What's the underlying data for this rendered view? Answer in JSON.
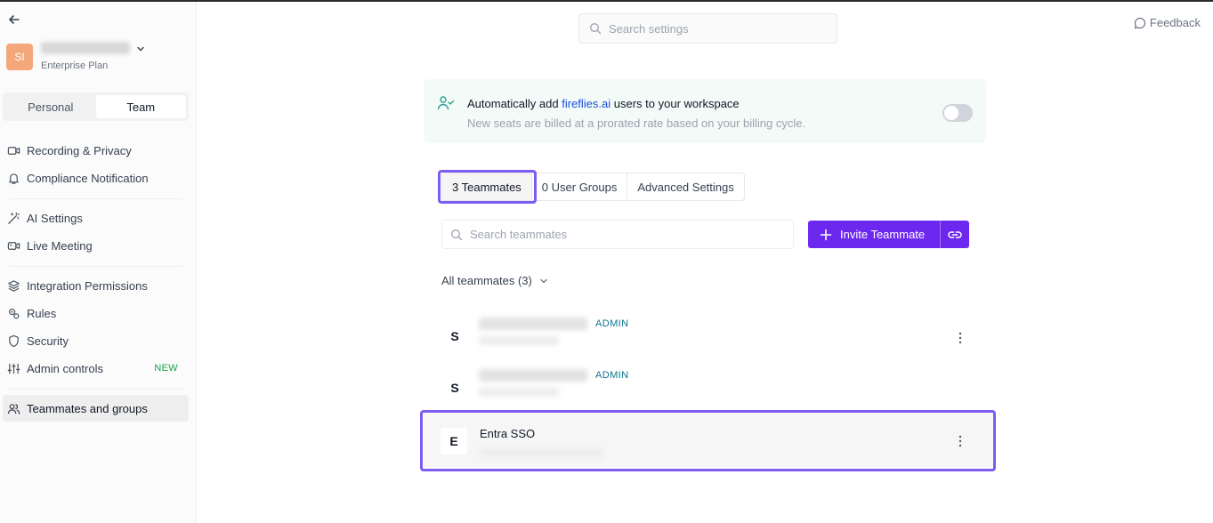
{
  "sidebar": {
    "account": {
      "initials": "SI",
      "plan": "Enterprise Plan"
    },
    "segment": {
      "personal": "Personal",
      "team": "Team"
    },
    "items": [
      {
        "label": "Recording & Privacy",
        "icon": "video-icon"
      },
      {
        "label": "Compliance Notification",
        "icon": "bell-icon"
      },
      {
        "label": "AI Settings",
        "icon": "magic-wand-icon"
      },
      {
        "label": "Live Meeting",
        "icon": "live-video-icon"
      },
      {
        "label": "Integration Permissions",
        "icon": "layers-icon"
      },
      {
        "label": "Rules",
        "icon": "gears-icon"
      },
      {
        "label": "Security",
        "icon": "shield-icon"
      },
      {
        "label": "Admin controls",
        "icon": "sliders-icon",
        "badge": "NEW"
      },
      {
        "label": "Teammates and groups",
        "icon": "users-icon",
        "active": true
      }
    ]
  },
  "header": {
    "search_placeholder": "Search settings",
    "feedback": "Feedback"
  },
  "banner": {
    "title_prefix": "Automatically add ",
    "title_link": "fireflies.ai",
    "title_suffix": " users to your workspace",
    "subtitle": "New seats are billed at a prorated rate based on your billing cycle.",
    "toggle_on": false
  },
  "tabs": [
    {
      "label": "3 Teammates",
      "active": true
    },
    {
      "label": "0 User Groups"
    },
    {
      "label": "Advanced Settings"
    }
  ],
  "teammates": {
    "search_placeholder": "Search teammates",
    "invite_label": "Invite Teammate",
    "filter_label": "All teammates (3)",
    "rows": [
      {
        "initial": "S",
        "role": "ADMIN"
      },
      {
        "initial": "S",
        "role": "ADMIN"
      },
      {
        "initial": "E",
        "name": "Entra SSO"
      }
    ]
  },
  "colors": {
    "accent": "#6d28f0",
    "highlight": "#7c5cf2",
    "avatar": "#f5a77c",
    "banner_bg": "#f2fbf8",
    "admin_badge": "#0e7490",
    "new_badge": "#16a34a"
  }
}
